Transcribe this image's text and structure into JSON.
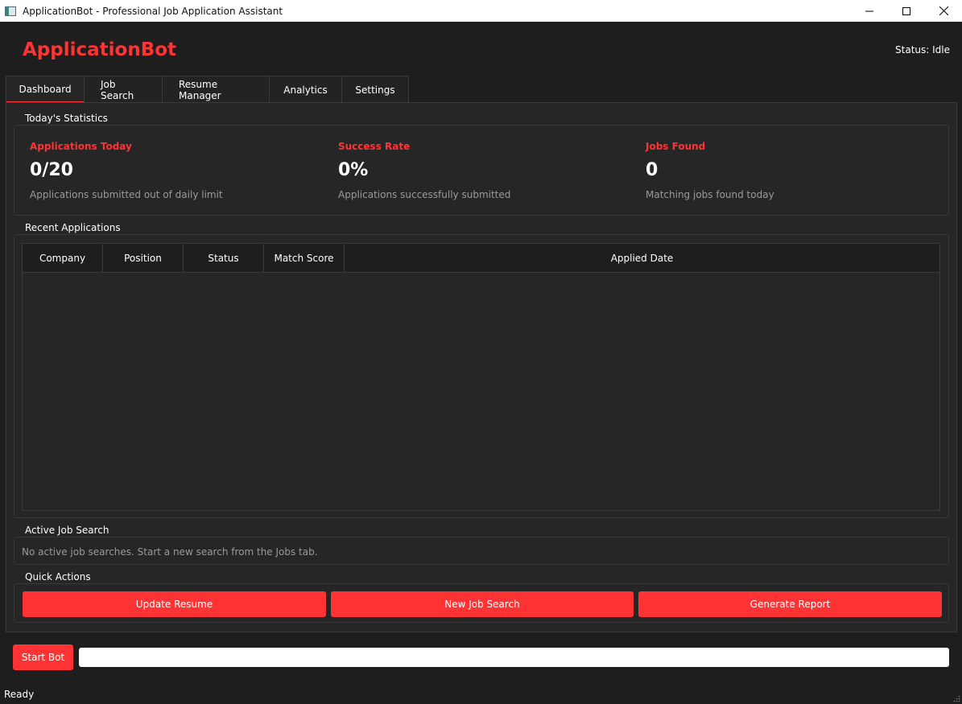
{
  "window": {
    "title": "ApplicationBot - Professional Job Application Assistant"
  },
  "header": {
    "logo": "ApplicationBot",
    "status": "Status: Idle"
  },
  "tabs": [
    {
      "label": "Dashboard",
      "active": true
    },
    {
      "label": "Job Search",
      "active": false
    },
    {
      "label": "Resume Manager",
      "active": false
    },
    {
      "label": "Analytics",
      "active": false
    },
    {
      "label": "Settings",
      "active": false
    }
  ],
  "stats": {
    "section_title": "Today's Statistics",
    "items": [
      {
        "label": "Applications Today",
        "value": "0/20",
        "description": "Applications submitted out of daily limit"
      },
      {
        "label": "Success Rate",
        "value": "0%",
        "description": "Applications successfully submitted"
      },
      {
        "label": "Jobs Found",
        "value": "0",
        "description": "Matching jobs found today"
      }
    ]
  },
  "recent_applications": {
    "section_title": "Recent Applications",
    "columns": [
      "Company",
      "Position",
      "Status",
      "Match Score",
      "Applied Date"
    ],
    "rows": []
  },
  "active_search": {
    "section_title": "Active Job Search",
    "message": "No active job searches. Start a new search from the Jobs tab."
  },
  "quick_actions": {
    "section_title": "Quick Actions",
    "buttons": [
      "Update Resume",
      "New Job Search",
      "Generate Report"
    ]
  },
  "bottom": {
    "start_button": "Start Bot",
    "progress": 0,
    "status_bar": "Ready"
  },
  "colors": {
    "accent": "#ff3333",
    "background": "#1e1e1e",
    "panel": "#262626",
    "border": "#3a3a3a"
  },
  "icons": {
    "app": "app-window-icon",
    "minimize": "minimize-icon",
    "maximize": "maximize-icon",
    "close": "close-icon",
    "grip": "resize-grip-icon"
  }
}
